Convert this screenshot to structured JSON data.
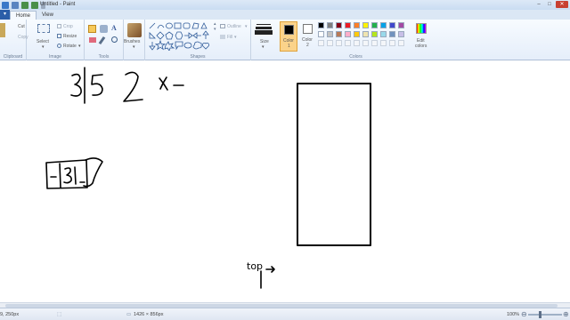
{
  "window": {
    "title": "Untitled - Paint"
  },
  "tabs": [
    {
      "label": "Home"
    },
    {
      "label": "View"
    }
  ],
  "clipboard": {
    "cut": "Cut",
    "copy": "Copy",
    "group": "Clipboard"
  },
  "image": {
    "select": "Select",
    "crop": "Crop",
    "resize": "Resize",
    "rotate": "Rotate",
    "group": "Image"
  },
  "tools": {
    "group": "Tools"
  },
  "brushes": {
    "label": "Brushes"
  },
  "shapes": {
    "outline": "Outline",
    "fill": "Fill",
    "group": "Shapes"
  },
  "size": {
    "label": "Size"
  },
  "colors": {
    "color1_label": "Color",
    "color1_num": "1",
    "color2_label": "Color",
    "color2_num": "2",
    "edit_label": "Edit",
    "edit_label2": "colors",
    "group": "Colors",
    "color1_value": "#000000",
    "color2_value": "#ffffff",
    "palette_row1": [
      "#000000",
      "#7f7f7f",
      "#880015",
      "#ed1c24",
      "#ff7f27",
      "#fff200",
      "#22b14c",
      "#00a2e8",
      "#3f48cc",
      "#a349a4"
    ],
    "palette_row2": [
      "#ffffff",
      "#c3c3c3",
      "#b97a57",
      "#ffaec9",
      "#ffc90e",
      "#efe4b0",
      "#b5e61d",
      "#99d9ea",
      "#7092be",
      "#c8bfe7"
    ]
  },
  "canvas": {
    "annotation": "top"
  },
  "status": {
    "cursor_pos": "9, 250px",
    "image_size": "1426 × 856px",
    "zoom": "100%"
  }
}
